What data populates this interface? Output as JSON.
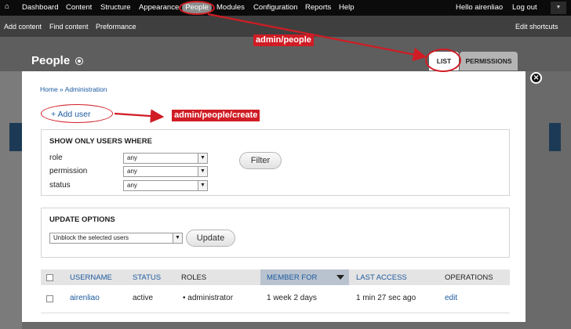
{
  "toolbar": {
    "home_icon": "home-icon",
    "items": [
      "Dashboard",
      "Content",
      "Structure",
      "Appearance",
      "People",
      "Modules",
      "Configuration",
      "Reports",
      "Help"
    ],
    "user_greeting": "Hello airenliao",
    "logout": "Log out"
  },
  "shortcuts": {
    "items": [
      "Add content",
      "Find content",
      "Preformance"
    ],
    "edit": "Edit shortcuts"
  },
  "page": {
    "title": "People",
    "tabs": [
      "LIST",
      "PERMISSIONS"
    ],
    "breadcrumb": "Home » Administration",
    "add_user": "+ Add user"
  },
  "filter": {
    "legend": "SHOW ONLY USERS WHERE",
    "fields": [
      {
        "label": "role",
        "value": "any"
      },
      {
        "label": "permission",
        "value": "any"
      },
      {
        "label": "status",
        "value": "any"
      }
    ],
    "button": "Filter"
  },
  "update": {
    "legend": "UPDATE OPTIONS",
    "selected": "Unblock the selected users",
    "button": "Update"
  },
  "table": {
    "headers": [
      "USERNAME",
      "STATUS",
      "ROLES",
      "MEMBER FOR",
      "LAST ACCESS",
      "OPERATIONS"
    ],
    "rows": [
      {
        "username": "airenliao",
        "status": "active",
        "roles": "• administrator",
        "member_for": "1 week 2 days",
        "last_access": "1 min 27 sec ago",
        "operations": "edit"
      }
    ]
  },
  "annotations": {
    "people_path": "admin/people",
    "create_path": "admin/people/create"
  },
  "colors": {
    "accent_link": "#1d5aa0",
    "annotation_red": "#d01c24",
    "toolbar_bg": "#0b0b0b"
  }
}
